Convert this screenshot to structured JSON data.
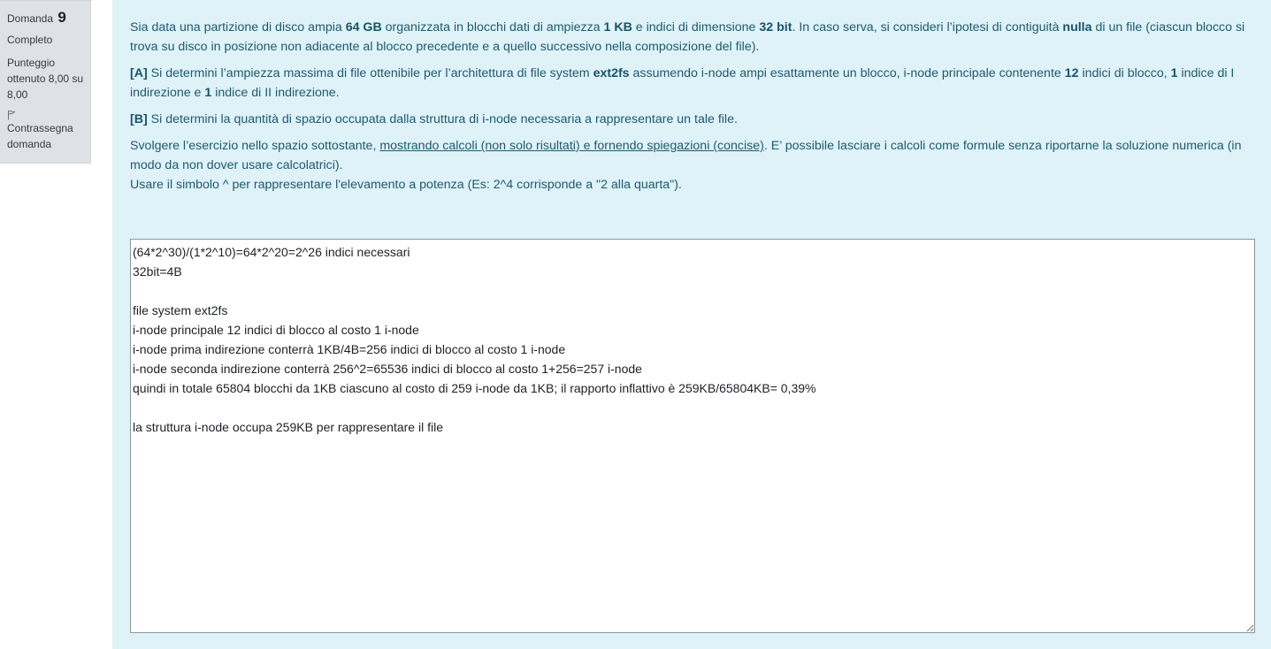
{
  "info": {
    "question_word": "Domanda",
    "question_number": "9",
    "state": "Completo",
    "grade": "Punteggio ottenuto 8,00 su 8,00",
    "flag_icon": "flag-icon",
    "flag_label": "Contrassegna domanda"
  },
  "question": {
    "p1": {
      "t1": "Sia data una partizione di disco ampia ",
      "b1": "64 GB",
      "t2": " organizzata in blocchi dati di ampiezza ",
      "b2": "1 KB",
      "t3": " e indici di dimensione ",
      "b3": "32 bit",
      "t4": ". In caso serva, si consideri l’ipotesi di contiguità ",
      "b4": "nulla",
      "t5": " di un file (ciascun blocco si trova su disco in posizione non adiacente al blocco precedente e a quello successivo nella composizione del file)."
    },
    "p2": {
      "b1": "[A]",
      "t1": " Si determini l’ampiezza massima di file ottenibile per l’architettura di file system ",
      "b2": "ext2fs",
      "t2": " assumendo i-node ampi esattamente un blocco, i-node principale contenente ",
      "b3": "12",
      "t3": " indici di blocco, ",
      "b4": "1",
      "t4": " indice di I indirezione e ",
      "b5": "1",
      "t5": " indice di II indirezione."
    },
    "p3": {
      "b1": "[B]",
      "t1": " Si determini la quantità di spazio occupata dalla struttura di i-node necessaria a rappresentare un tale file."
    },
    "p4": {
      "t1": "Svolgere l’esercizio nello spazio sottostante, ",
      "u1": "mostrando calcoli (non solo risultati) e fornendo spiegazioni (concise)",
      "t2": ". E’ possibile lasciare i calcoli come formule senza riportarne la soluzione numerica (in modo da non dover usare calcolatrici).",
      "t3": "Usare il simbolo ^ per rappresentare l'elevamento a potenza (Es: 2^4 corrisponde a \"2 alla quarta\")."
    }
  },
  "answer": {
    "text": "(64*2^30)/(1*2^10)=64*2^20=2^26 indici necessari\n32bit=4B\n\nfile system ext2fs\ni-node principale 12 indici di blocco al costo 1 i-node\ni-node prima indirezione conterrà 1KB/4B=256 indici di blocco al costo 1 i-node\ni-node seconda indirezione conterrà 256^2=65536 indici di blocco al costo 1+256=257 i-node\nquindi in totale 65804 blocchi da 1KB ciascuno al costo di 259 i-node da 1KB; il rapporto inflattivo è 259KB/65804KB= 0,39%\n\nla struttura i-node occupa 259KB per rappresentare il file"
  }
}
